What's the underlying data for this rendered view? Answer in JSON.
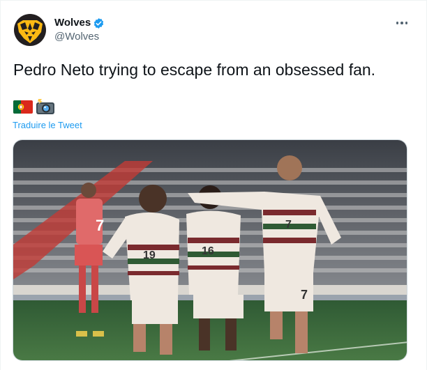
{
  "tweet": {
    "author": {
      "display_name": "Wolves",
      "handle": "@Wolves",
      "verified": true,
      "avatar_icon": "wolf-head-logo-icon"
    },
    "text": "Pedro Neto trying to escape from an obsessed fan.",
    "emojis": [
      "portugal-flag-icon",
      "camera-with-flash-icon"
    ],
    "translate_label": "Traduire le Tweet",
    "more_icon": "more-options-icon",
    "media": {
      "description_icon": "football-celebration-photo",
      "jersey_numbers": [
        "19",
        "16",
        "7",
        "7"
      ]
    }
  },
  "colors": {
    "link": "#1d9bf0",
    "verified": "#1d9bf0",
    "secondary_text": "#536471",
    "avatar_bg": "#231f20",
    "avatar_gold": "#fdb913"
  }
}
